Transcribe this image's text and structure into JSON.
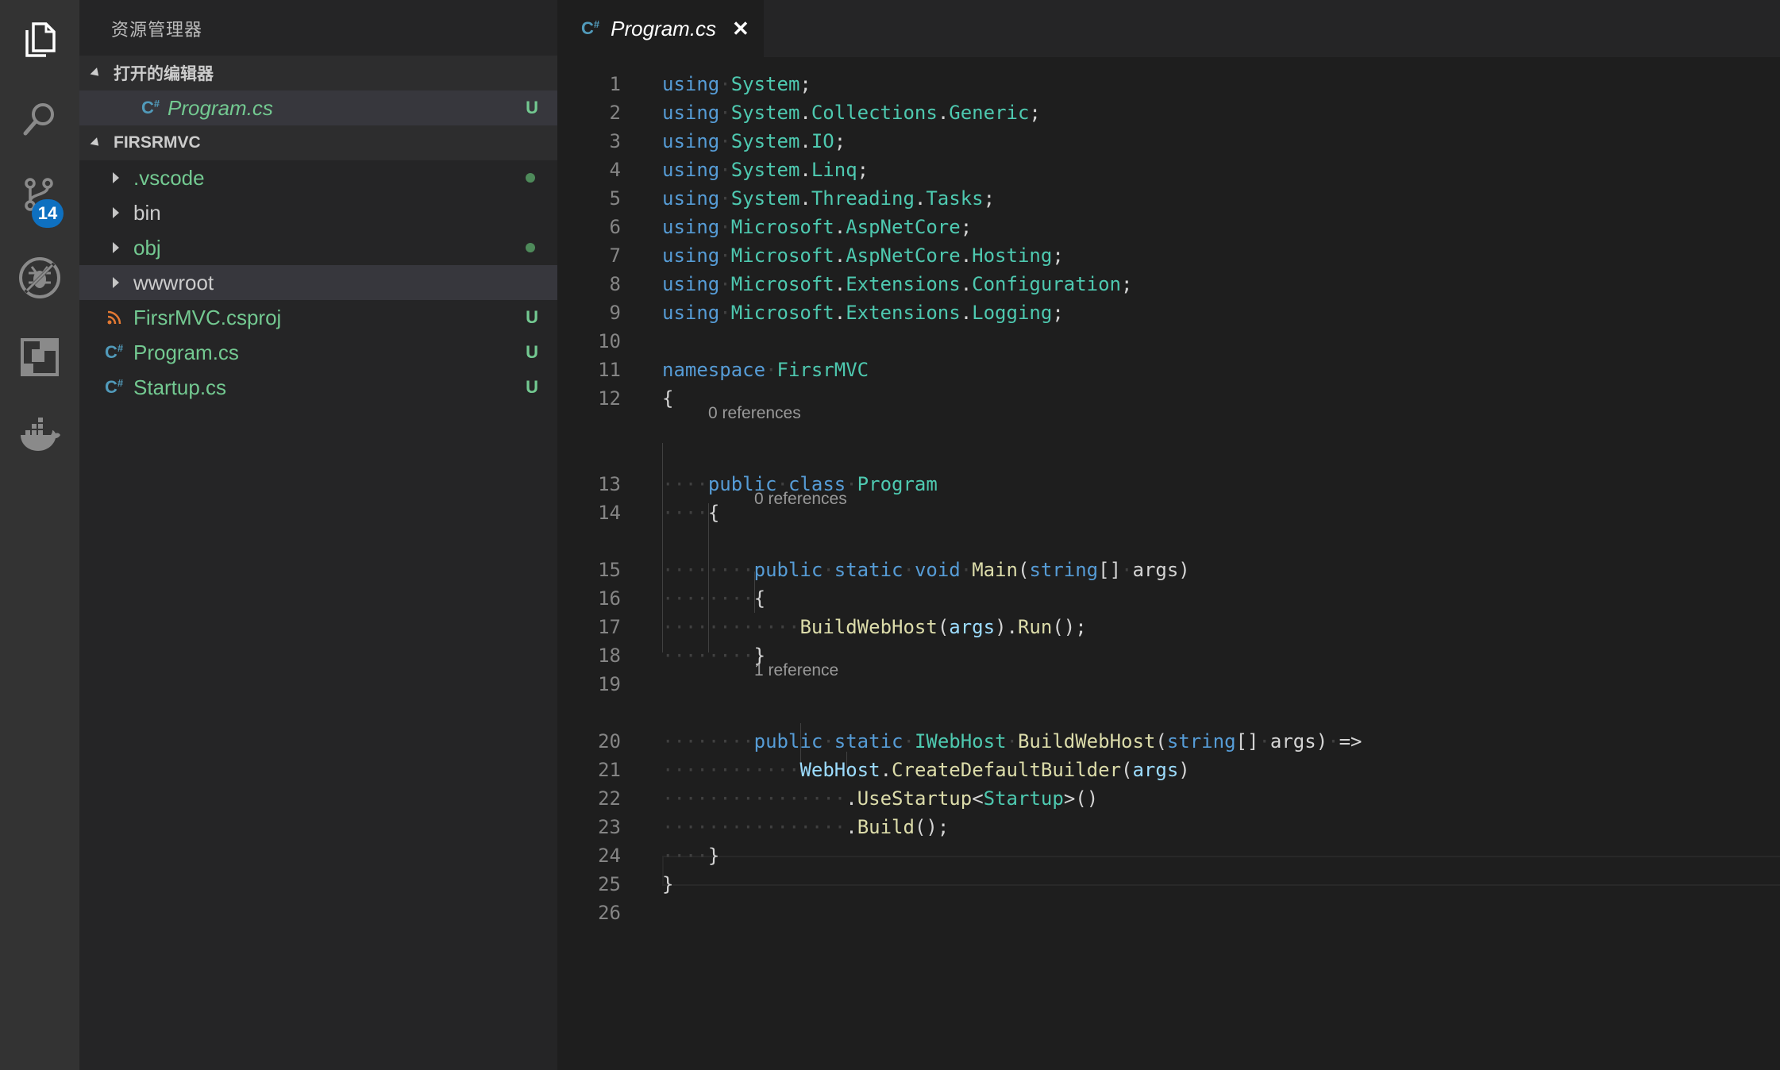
{
  "sidebar": {
    "title": "资源管理器",
    "open_editors": {
      "label": "打开的编辑器",
      "items": [
        {
          "name": "Program.cs",
          "status": "U"
        }
      ]
    },
    "project": {
      "label": "FIRSRMVC",
      "folders": [
        {
          "name": ".vscode",
          "modified": true
        },
        {
          "name": "bin",
          "modified": false
        },
        {
          "name": "obj",
          "modified": true
        },
        {
          "name": "wwwroot",
          "modified": false
        }
      ],
      "files": [
        {
          "name": "FirsrMVC.csproj",
          "status": "U",
          "icon": "rss-icon"
        },
        {
          "name": "Program.cs",
          "status": "U",
          "icon": "csharp-icon"
        },
        {
          "name": "Startup.cs",
          "status": "U",
          "icon": "csharp-icon"
        }
      ]
    }
  },
  "activity_bar": {
    "items": [
      "explorer-icon",
      "search-icon",
      "source-control-icon",
      "debug-icon",
      "extensions-icon",
      "docker-icon"
    ],
    "source_control_badge": "14"
  },
  "tab": {
    "label": "Program.cs",
    "icon_text": "C",
    "close": "✕"
  },
  "editor": {
    "line_numbers": [
      "1",
      "2",
      "3",
      "4",
      "5",
      "6",
      "7",
      "8",
      "9",
      "10",
      "11",
      "12",
      "13",
      "14",
      "15",
      "16",
      "17",
      "18",
      "19",
      "20",
      "21",
      "22",
      "23",
      "24",
      "25",
      "26"
    ],
    "code_lens": {
      "class_program": "0 references",
      "main": "0 references",
      "build_web_host": "1 reference"
    },
    "lines": {
      "l1": "using·System;",
      "l2": "using·System.Collections.Generic;",
      "l3": "using·System.IO;",
      "l4": "using·System.Linq;",
      "l5": "using·System.Threading.Tasks;",
      "l6": "using·Microsoft.AspNetCore;",
      "l7": "using·Microsoft.AspNetCore.Hosting;",
      "l8": "using·Microsoft.Extensions.Configuration;",
      "l9": "using·Microsoft.Extensions.Logging;",
      "l11": "namespace·FirsrMVC",
      "l12": "{",
      "l13": "····public·class·Program",
      "l14": "····{",
      "l15": "········public·static·void·Main(string[]·args)",
      "l16": "········{",
      "l17": "············BuildWebHost(args).Run();",
      "l18": "········}",
      "l20": "········public·static·IWebHost·BuildWebHost(string[]·args)·=>",
      "l21": "············WebHost.CreateDefaultBuilder(args)",
      "l22": "················.UseStartup<Startup>()",
      "l23": "················.Build();",
      "l24": "····}",
      "l25": "}"
    }
  },
  "colors": {
    "activity_bar": "#333333",
    "sidebar": "#252526",
    "editor": "#1e1e1e",
    "keyword": "#569cd6",
    "type": "#4ec9b0",
    "function": "#dcdcaa",
    "variable": "#9cdcfe",
    "untracked": "#73c991",
    "badge": "#0e70c0"
  }
}
